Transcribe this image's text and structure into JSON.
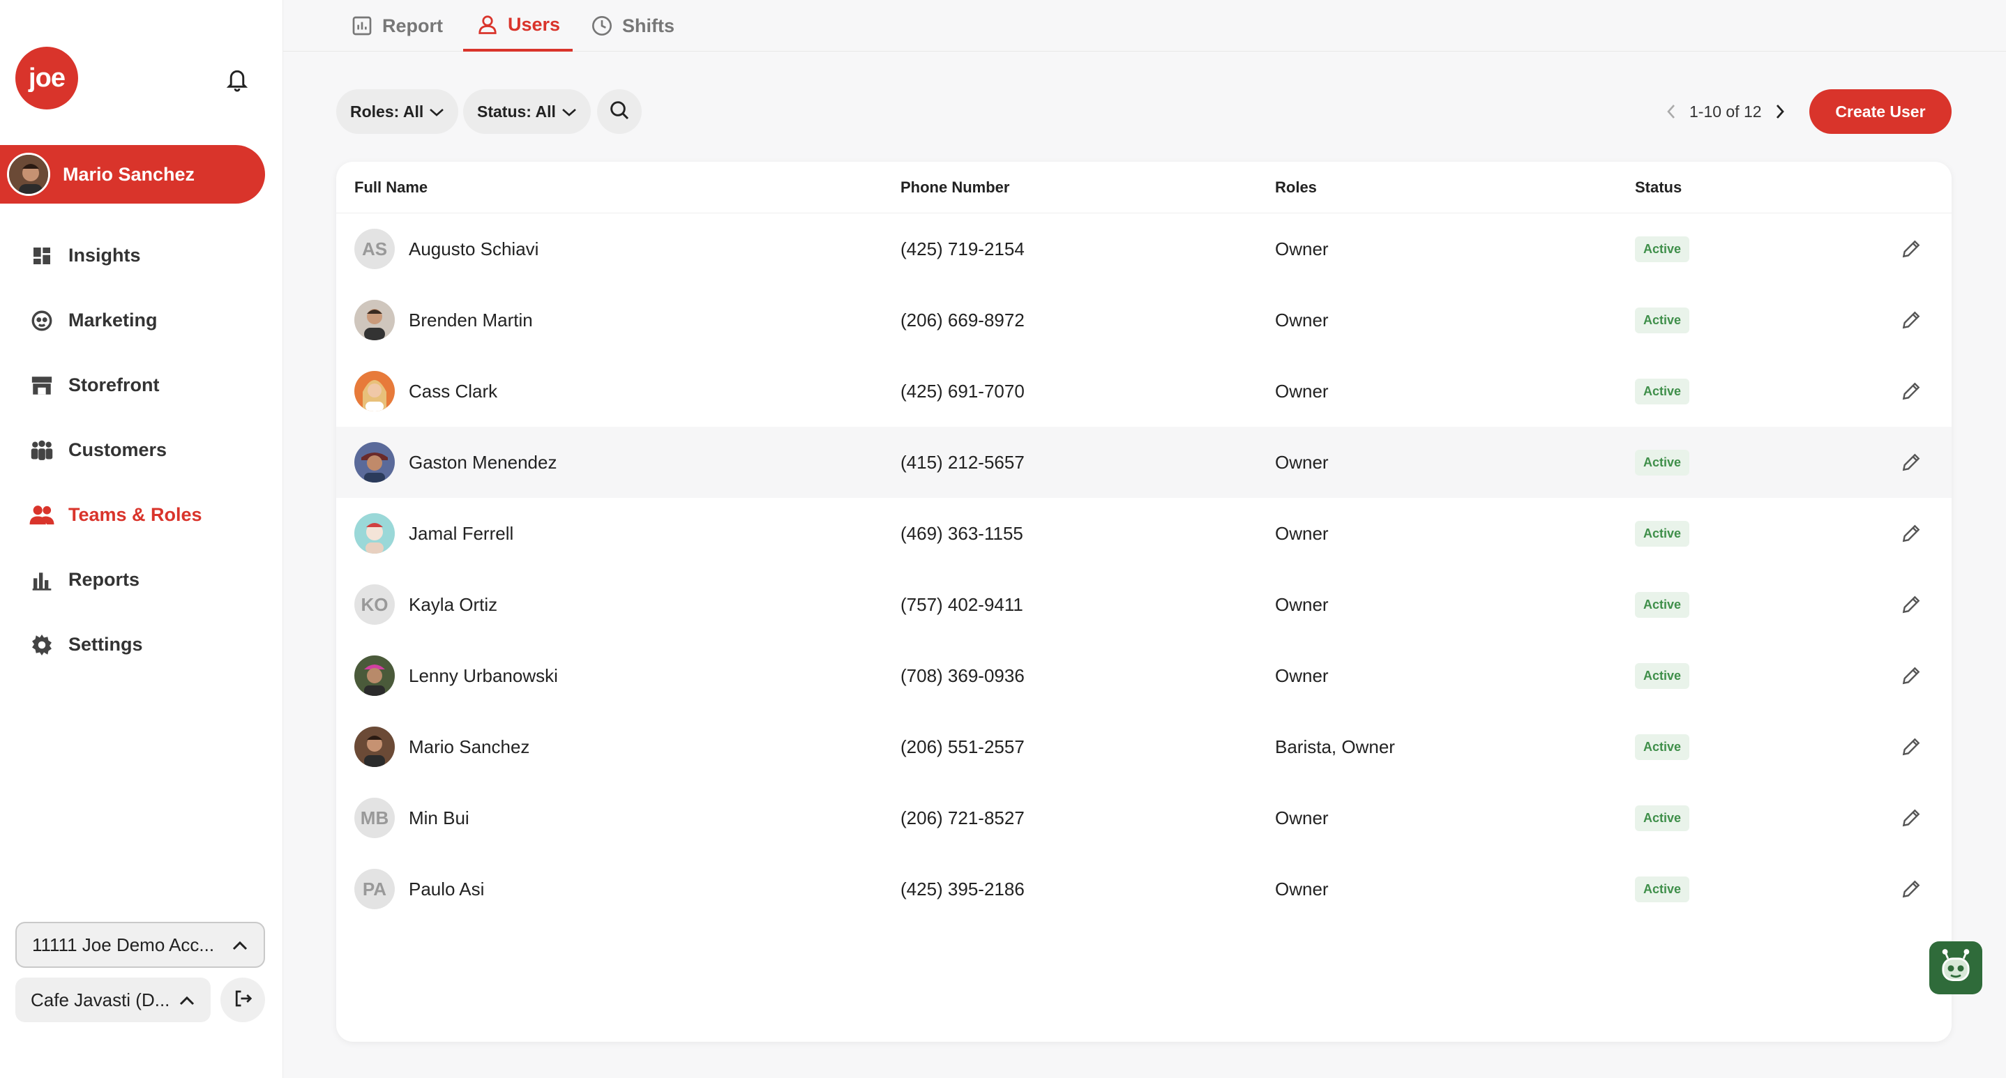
{
  "app": {
    "logo_text": "joe",
    "brand_color": "#d9342b"
  },
  "sidebar": {
    "current_user": "Mario Sanchez",
    "items": [
      {
        "label": "Insights",
        "icon": "grid-icon"
      },
      {
        "label": "Marketing",
        "icon": "megaphone-icon"
      },
      {
        "label": "Storefront",
        "icon": "store-icon"
      },
      {
        "label": "Customers",
        "icon": "people-icon"
      },
      {
        "label": "Teams & Roles",
        "icon": "team-icon",
        "active": true
      },
      {
        "label": "Reports",
        "icon": "bar-chart-icon"
      },
      {
        "label": "Settings",
        "icon": "gear-icon"
      }
    ],
    "account_select": "11111 Joe Demo Acc...",
    "store_select": "Cafe Javasti (D..."
  },
  "tabs": [
    {
      "label": "Report",
      "icon": "report-icon"
    },
    {
      "label": "Users",
      "icon": "user-icon",
      "active": true
    },
    {
      "label": "Shifts",
      "icon": "clock-icon"
    }
  ],
  "filters": {
    "roles": "Roles: All",
    "status": "Status: All"
  },
  "pager": {
    "text": "1-10 of 12"
  },
  "create_button": "Create User",
  "table": {
    "headers": [
      "Full Name",
      "Phone Number",
      "Roles",
      "Status"
    ],
    "rows": [
      {
        "initials": "AS",
        "name": "Augusto Schiavi",
        "phone": "(425) 719-2154",
        "roles": "Owner",
        "status": "Active"
      },
      {
        "initials": "",
        "name": "Brenden Martin",
        "phone": "(206) 669-8972",
        "roles": "Owner",
        "status": "Active"
      },
      {
        "initials": "",
        "name": "Cass Clark",
        "phone": "(425) 691-7070",
        "roles": "Owner",
        "status": "Active"
      },
      {
        "initials": "",
        "name": "Gaston Menendez",
        "phone": "(415) 212-5657",
        "roles": "Owner",
        "status": "Active"
      },
      {
        "initials": "",
        "name": "Jamal Ferrell",
        "phone": "(469) 363-1155",
        "roles": "Owner",
        "status": "Active"
      },
      {
        "initials": "KO",
        "name": "Kayla Ortiz",
        "phone": "(757) 402-9411",
        "roles": "Owner",
        "status": "Active"
      },
      {
        "initials": "",
        "name": "Lenny Urbanowski",
        "phone": "(708) 369-0936",
        "roles": "Owner",
        "status": "Active"
      },
      {
        "initials": "",
        "name": "Mario Sanchez",
        "phone": "(206) 551-2557",
        "roles": "Barista, Owner",
        "status": "Active"
      },
      {
        "initials": "MB",
        "name": "Min Bui",
        "phone": "(206) 721-8527",
        "roles": "Owner",
        "status": "Active"
      },
      {
        "initials": "PA",
        "name": "Paulo Asi",
        "phone": "(425) 395-2186",
        "roles": "Owner",
        "status": "Active"
      }
    ]
  }
}
